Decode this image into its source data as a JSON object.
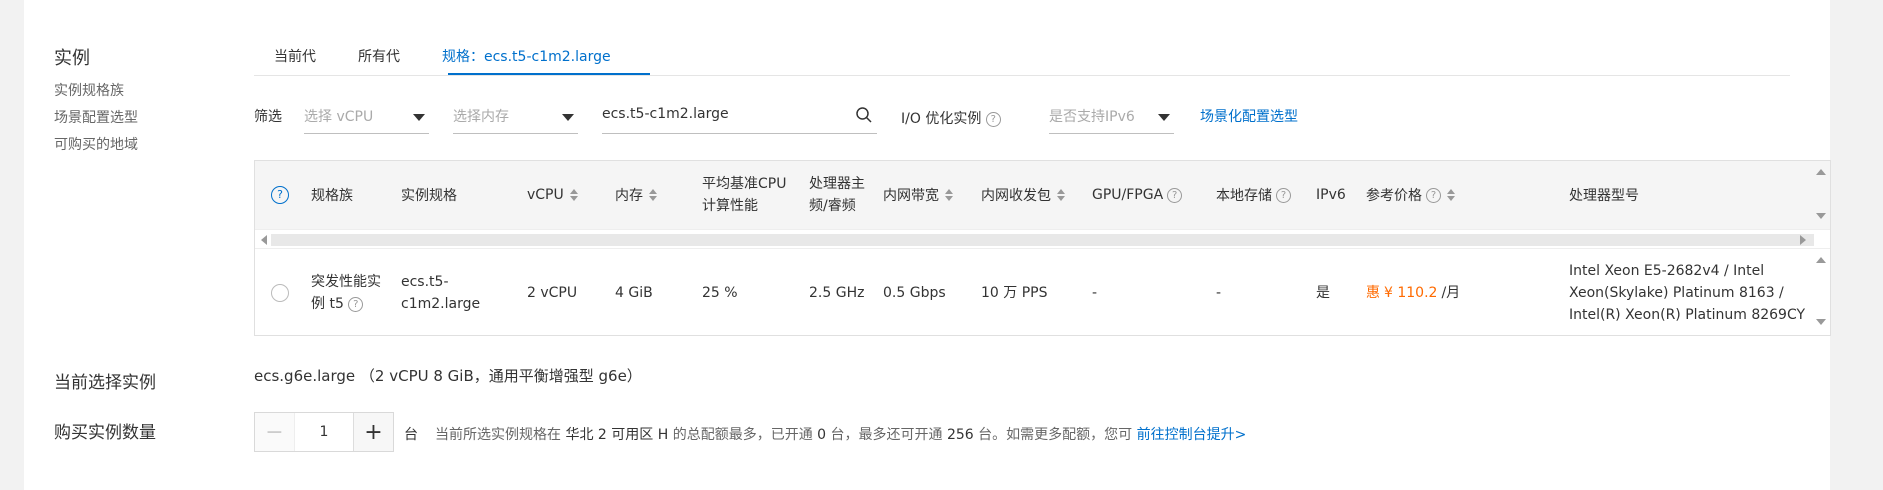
{
  "sidebar": {
    "title": "实例",
    "items": [
      "实例规格族",
      "场景配置选型",
      "可购买的地域"
    ]
  },
  "tabs": [
    {
      "label": "当前代",
      "active": false
    },
    {
      "label": "所有代",
      "active": false
    },
    {
      "label": "规格：ecs.t5-c1m2.large",
      "active": true
    }
  ],
  "filters": {
    "label": "筛选",
    "vcpu_placeholder": "选择 vCPU",
    "memory_placeholder": "选择内存",
    "search_value": "ecs.t5-c1m2.large",
    "io_label": "I/O 优化实例",
    "ipv6_placeholder": "是否支持IPv6",
    "scene_link": "场景化配置选型"
  },
  "table": {
    "headers": {
      "family": "规格族",
      "spec": "实例规格",
      "vcpu": "vCPU",
      "memory": "内存",
      "cpu_perf_line1": "平均基准CPU",
      "cpu_perf_line2": "计算性能",
      "freq_line1": "处理器主",
      "freq_line2": "频/睿频",
      "bandwidth": "内网带宽",
      "pps": "内网收发包",
      "gpu": "GPU/FPGA",
      "local_storage": "本地存储",
      "ipv6": "IPv6",
      "price": "参考价格",
      "cpu_model": "处理器型号"
    },
    "rows": [
      {
        "family_line1": "突发性能实",
        "family_line2": "例 t5",
        "spec_line1": "ecs.t5-",
        "spec_line2": "c1m2.large",
        "vcpu": "2 vCPU",
        "memory": "4 GiB",
        "cpu_perf": "25 %",
        "freq": "2.5 GHz",
        "bandwidth": "0.5 Gbps",
        "pps": "10 万 PPS",
        "gpu": "-",
        "local_storage": "-",
        "ipv6": "是",
        "price_prefix": "惠",
        "price_value": "¥ 110.2",
        "price_unit": "/月",
        "cpu_model_line1": "Intel Xeon E5-2682v4 / Intel",
        "cpu_model_line2": "Xeon(Skylake) Platinum 8163 /",
        "cpu_model_line3": "Intel(R) Xeon(R) Platinum 8269CY"
      }
    ]
  },
  "current": {
    "label": "当前选择实例",
    "value": "ecs.g6e.large （2 vCPU 8 GiB，通用平衡增强型 g6e）"
  },
  "quantity": {
    "label": "购买实例数量",
    "value": "1",
    "unit": "台",
    "note_pre": "当前所选实例规格在",
    "note_region": "华北 2 可用区 H",
    "note_mid1": "的总配额最多，已开通",
    "note_opened": "0",
    "note_mid2": "台，最多还可开通",
    "note_remaining": "256",
    "note_mid3": "台。如需更多配额，您可",
    "note_link": "前往控制台提升>"
  },
  "colors": {
    "accent": "#0070cc",
    "price": "#ff6a00"
  }
}
